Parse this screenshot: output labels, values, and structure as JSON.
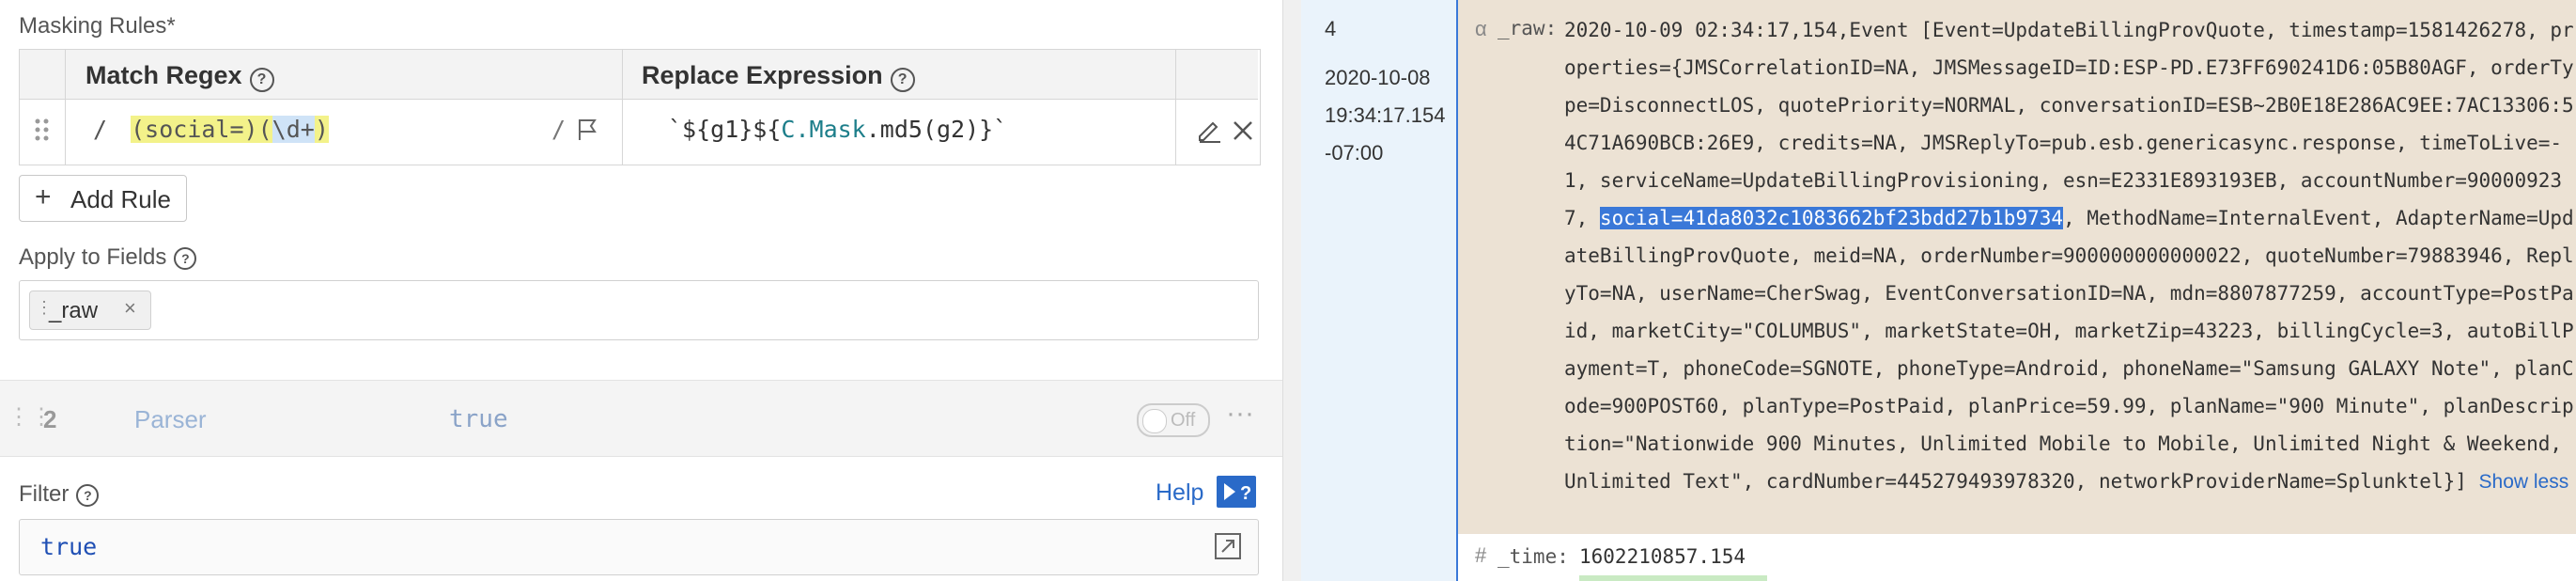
{
  "left": {
    "masking_label": "Masking Rules*",
    "columns": {
      "regex": "Match Regex",
      "replace": "Replace Expression"
    },
    "rule": {
      "slash_open": "/",
      "regex_parts": [
        "(social",
        "=",
        ")",
        "(",
        "\\d+",
        ")"
      ],
      "slash_close": "/",
      "replace_parts": [
        "`${g1}${",
        "C.Mask",
        ".md5(g2)}`"
      ]
    },
    "add_rule_label": "Add Rule",
    "apply_fields_label": "Apply to Fields",
    "field_chip": "_raw",
    "function_row": {
      "number": "2",
      "name": "Parser",
      "filter": "true",
      "toggle_label": "Off"
    },
    "filter_label": "Filter",
    "help_label": "Help",
    "filter_value": "true"
  },
  "right": {
    "event_number": "4",
    "event_date": "2020-10-08",
    "event_time": "19:34:17.154",
    "event_tz": "-07:00",
    "raw_type_icon": "α",
    "raw_key": "_raw:",
    "raw_before": "2020-10-09 02:34:17,154,Event [Event=UpdateBillingProvQuote, timestamp=1581426278, properties={JMSCorrelationID=NA, JMSMessageID=ID:ESP-PD.E73FF690241D6:05B80AGF, orderType=DisconnectLOS, quotePriority=NORMAL, conversationID=ESB~2B0E18E286AC9EE:7AC13306:54C71A690BCB:26E9, credits=NA, JMSReplyTo=pub.esb.genericasync.response, timeToLive=-1, serviceName=UpdateBillingProvisioning, esn=E2331E893193EB, accountNumber=900009237, ",
    "raw_selected": "social=41da8032c1083662bf23bdd27b1b9734",
    "raw_after": ", MethodName=InternalEvent, AdapterName=UpdateBillingProvQuote, meid=NA, orderNumber=900000000000022, quoteNumber=79883946, ReplyTo=NA, userName=CherSwag, EventConversationID=NA, mdn=8807877259, accountType=PostPaid, marketCity=\"COLUMBUS\", marketState=OH, marketZip=43223, billingCycle=3, autoBillPayment=T, phoneCode=SGNOTE, phoneType=Android, phoneName=\"Samsung GALAXY Note\", planCode=900POST60, planType=PostPaid, planPrice=59.99, planName=\"900 Minute\", planDescription=\"Nationwide 900 Minutes, Unlimited Mobile to Mobile, Unlimited Night & Weekend, Unlimited Text\", cardNumber=445279493978320, networkProviderName=Splunktel}]",
    "show_less": "Show less",
    "time_type_icon": "#",
    "time_key": "_time:",
    "time_value": "1602210857.154"
  },
  "colors": {
    "accent_blue": "#2a6ac8",
    "highlight_yellow": "#f3f28a",
    "highlight_blue": "#cfe3f7",
    "raw_bg": "#ece2d4",
    "selection": "#3a78d8"
  }
}
